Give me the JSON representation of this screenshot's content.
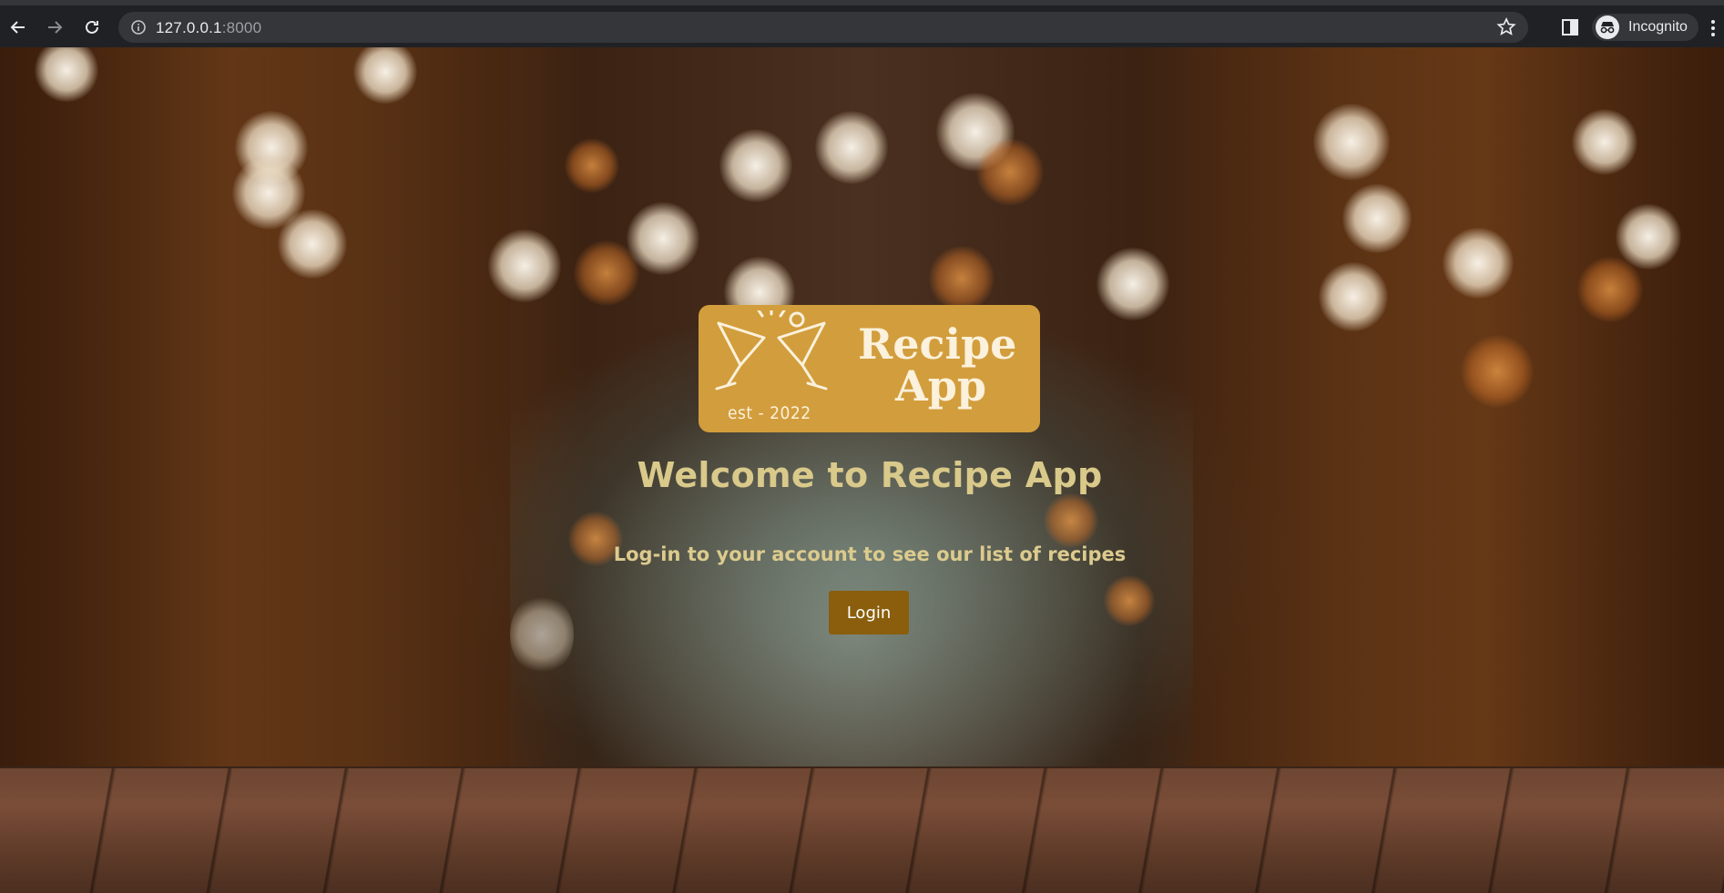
{
  "browser": {
    "url_host": "127.0.0.1",
    "url_port": ":8000",
    "profile_label": "Incognito"
  },
  "page": {
    "logo": {
      "title_line1": "Recipe",
      "title_line2": "App",
      "tagline": "est  -  2022",
      "color": "#d29d3c"
    },
    "heading": "Welcome to Recipe App",
    "subtitle": "Log-in to your account to see our list of recipes",
    "login_button": "Login",
    "accent_color": "#8a5e0c",
    "text_color": "#d9c98a"
  }
}
